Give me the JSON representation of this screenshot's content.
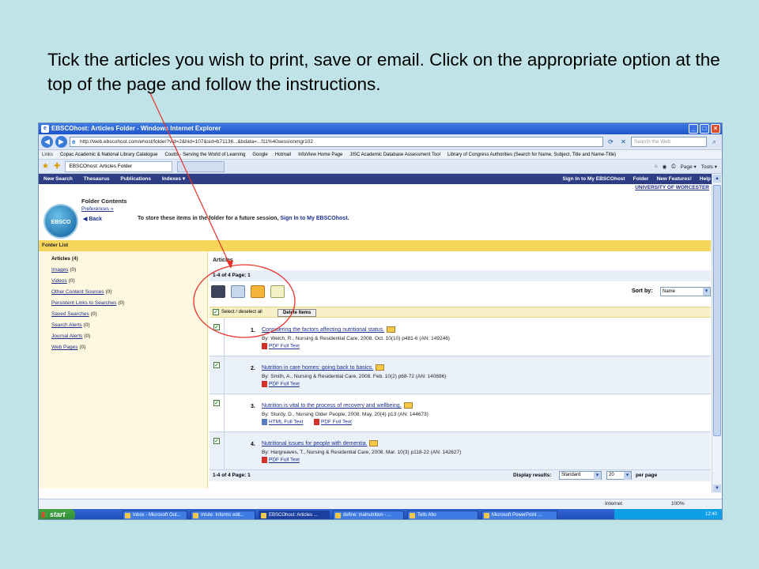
{
  "caption": "Tick the articles you wish to print, save or email. Click on the appropriate option at the top of the page and follow the instructions.",
  "window": {
    "title": "EBSCOhost: Articles Folder - Windows Internet Explorer",
    "minimize": "_",
    "maximize": "□",
    "close": "×"
  },
  "address_bar": {
    "back": "◀",
    "forward": "▶",
    "url": "http://web.ebscohost.com/ehost/folder?vid=2&hid=107&sid=b71136...&bdata=...f11%40sessionmgr102",
    "search_placeholder": "Search the Web"
  },
  "links": {
    "label": "Links",
    "items": [
      "Copac Academic & National Library Catalogue",
      "Coutts - Serving the World of Learning",
      "Google",
      "Hotmail",
      "InfoView Home Page",
      "JISC Academic Database Assessment Tool",
      "Library of Congress Authorities (Search for Name, Subject, Title and Name-Title)"
    ]
  },
  "tab": {
    "label": "EBSCOhost: Articles Folder"
  },
  "commandbar": {
    "page": "Page ▾",
    "tools": "Tools ▾"
  },
  "ebsco_nav": {
    "left": [
      "New Search",
      "Thesaurus",
      "Publications",
      "Indexes ▾"
    ],
    "right": [
      "Sign In to My EBSCOhost",
      "Folder",
      "New Features!",
      "Help"
    ],
    "university": "UNIVERSITY OF WORCESTER"
  },
  "folder": {
    "logo": "EBSCO",
    "title": "Folder Contents",
    "preferences": "Preferences »",
    "back": "◀ Back",
    "store_text": "To store these items in the folder for a future session, ",
    "store_link": "Sign In to My EBSCOhost",
    "folder_list": "Folder List"
  },
  "sidebar": {
    "items": [
      {
        "label": "Articles",
        "count": "(4)"
      },
      {
        "label": "Images",
        "count": "(0)"
      },
      {
        "label": "Videos",
        "count": "(0)"
      },
      {
        "label": "Other Content Sources",
        "count": "(0)"
      },
      {
        "label": "Persistent Links to Searches",
        "count": "(0)"
      },
      {
        "label": "Saved Searches",
        "count": "(0)"
      },
      {
        "label": "Search Alerts",
        "count": "(0)"
      },
      {
        "label": "Journal Alerts",
        "count": "(0)"
      },
      {
        "label": "Web Pages",
        "count": "(0)"
      }
    ]
  },
  "main": {
    "header": "Articles",
    "pagination": "1-4 of 4   Page: 1",
    "sort_label": "Sort by:",
    "sort_value": "Name",
    "select_label": "Select / deselect all",
    "delete_button": "Delete Items",
    "check": "✓",
    "results": [
      {
        "num": "1.",
        "title": "Considering the factors affecting nutritional status.",
        "by": "By: Welch, R., Nursing & Residential Care, 2008. Oct. 10(10) p481-6 (AN: 149246)",
        "links": [
          "PDF Full Text"
        ]
      },
      {
        "num": "2.",
        "title": "Nutrition in care homes: going back to basics.",
        "by": "By: Smith, A., Nursing & Residential Care, 2008. Feb. 10(2) p68-72 (AN: 140696)",
        "links": [
          "PDF Full Text"
        ]
      },
      {
        "num": "3.",
        "title": "Nutrition is vital to the process of recovery and wellbeing.",
        "by": "By: Sturdy, D., Nursing Older People, 2008. May. 20(4) p13 (AN: 144673)",
        "links": [
          "HTML Full Text",
          "PDF Full Text"
        ]
      },
      {
        "num": "4.",
        "title": "Nutritional issues for people with dementia.",
        "by": "By: Hargreaves, T., Nursing & Residential Care, 2008. Mar. 10(3) p118-22 (AN: 142627)",
        "links": [
          "PDF Full Text"
        ]
      }
    ],
    "footer_pagination": "1-4 of 4   Page: 1",
    "display_label": "Display results:",
    "display_value": "Standard",
    "perpage_value": "20",
    "perpage_label": "per page"
  },
  "status": {
    "internet": "Internet",
    "zoom": "100%"
  },
  "taskbar": {
    "start": "start",
    "tasks": [
      "Inbox - Microsoft Out...",
      "Intute: Informs edit...",
      "EBSCOhost: Articles ...",
      "define: malnutrition - ...",
      "Tells Alto",
      "Microsoft PowerPoint ..."
    ],
    "clock": "12:40"
  },
  "annotation_color": "#e8322b"
}
